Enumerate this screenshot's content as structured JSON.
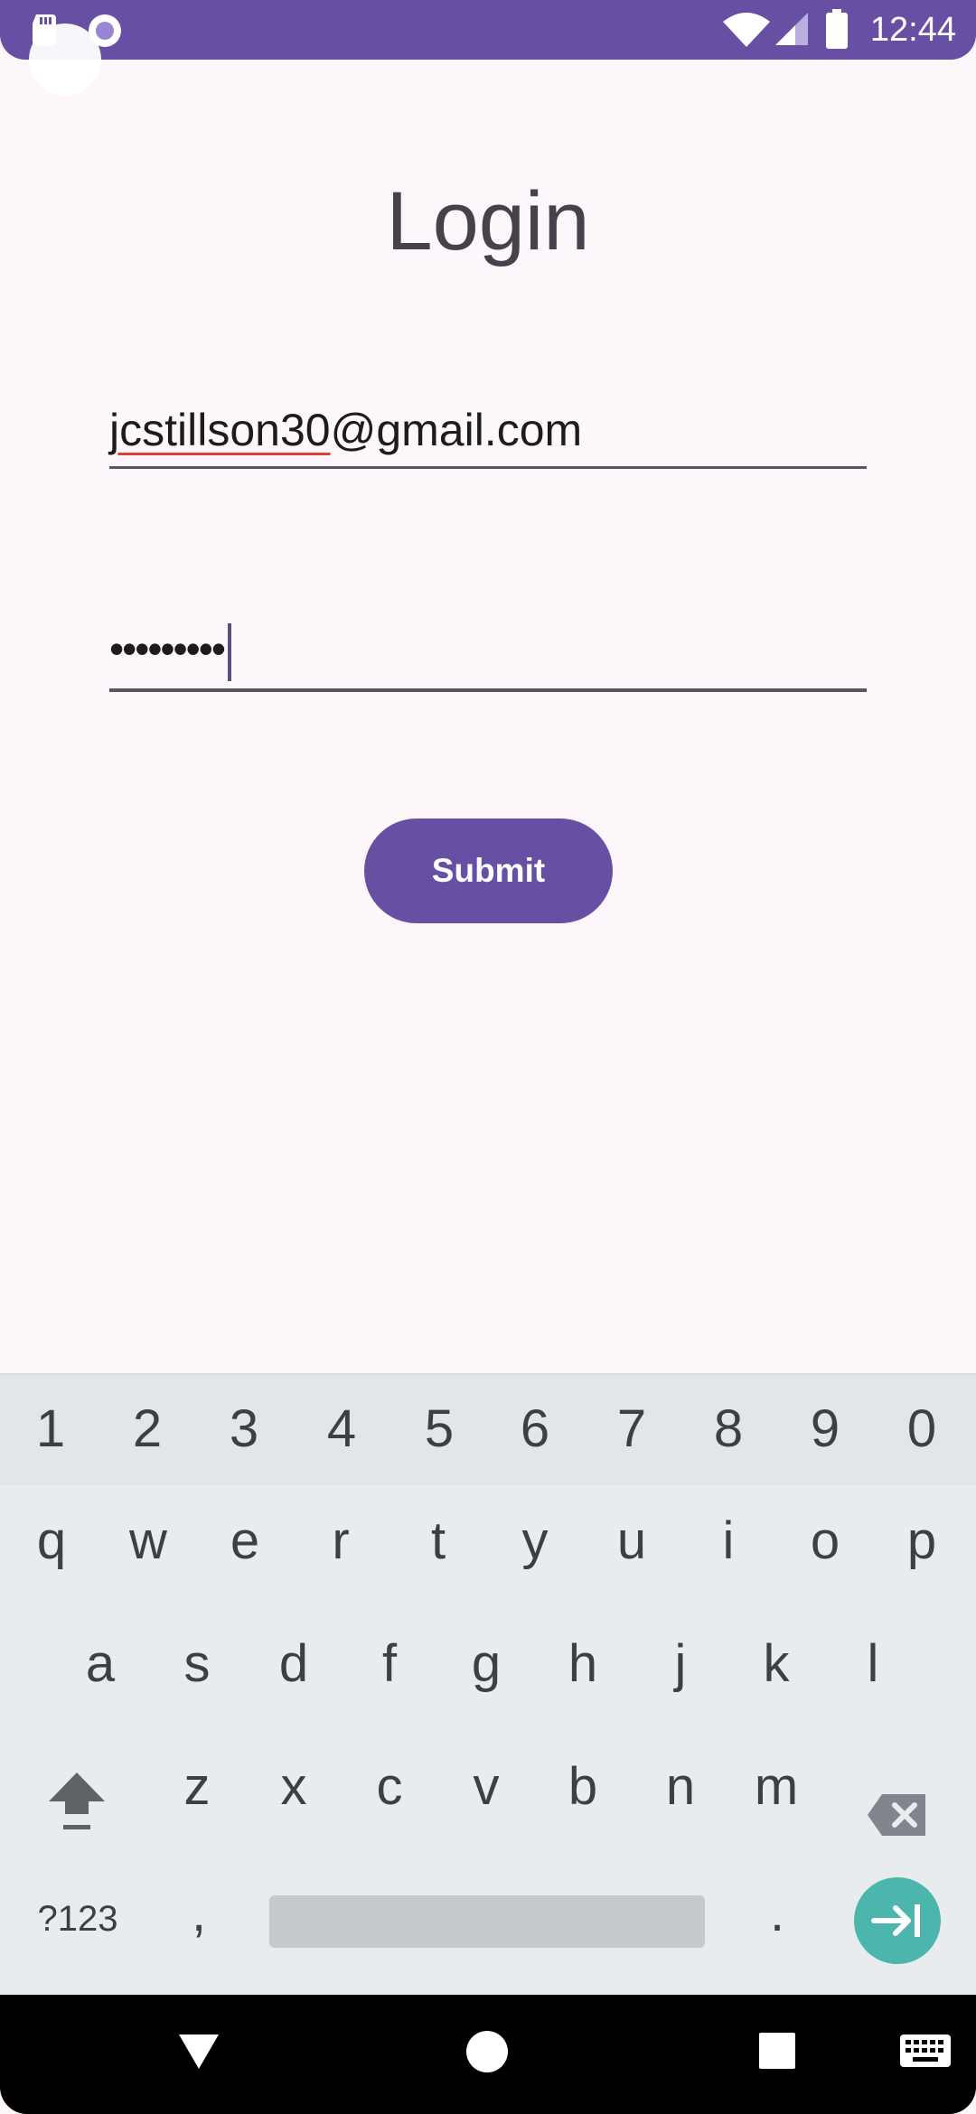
{
  "status_bar": {
    "time": "12:44",
    "background_color": "#6750a4"
  },
  "login": {
    "title": "Login",
    "email_value": "jcstillson30@gmail.com",
    "email_misspelled_part": "jcstillson30",
    "email_rest": "@gmail.com",
    "password_masked": "•••••••••",
    "submit_label": "Submit",
    "accent_color": "#6750a4"
  },
  "keyboard": {
    "number_row": [
      "1",
      "2",
      "3",
      "4",
      "5",
      "6",
      "7",
      "8",
      "9",
      "0"
    ],
    "row1": [
      "q",
      "w",
      "e",
      "r",
      "t",
      "y",
      "u",
      "i",
      "o",
      "p"
    ],
    "row2": [
      "a",
      "s",
      "d",
      "f",
      "g",
      "h",
      "j",
      "k",
      "l"
    ],
    "row3": [
      "z",
      "x",
      "c",
      "v",
      "b",
      "n",
      "m"
    ],
    "symbols_label": "?123",
    "comma_label": ",",
    "period_label": ".",
    "enter_color": "#4db6ac"
  },
  "nav_bar": {
    "icons": [
      "back-icon",
      "home-icon",
      "recents-icon",
      "keyboard-switch-icon"
    ]
  }
}
